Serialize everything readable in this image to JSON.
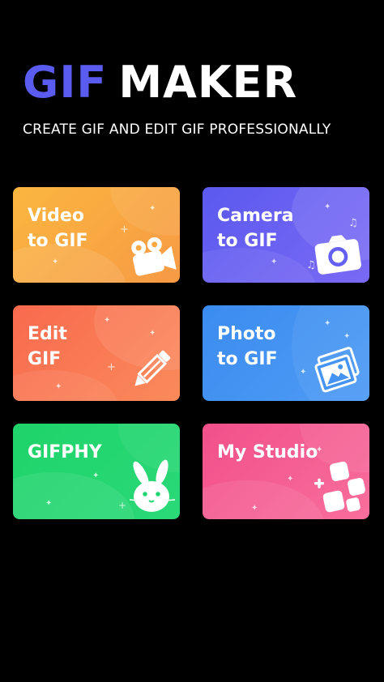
{
  "header": {
    "title_part1": "GIF",
    "title_part2": "MAKER",
    "subtitle": "CREATE GIF AND EDIT GIF PROFESSIONALLY"
  },
  "cards": {
    "video_to_gif": {
      "label": "Video\nto GIF",
      "icon": "video-camera-icon",
      "color": "#f9a842"
    },
    "camera_to_gif": {
      "label": "Camera\nto GIF",
      "icon": "photo-camera-icon",
      "color": "#6461f2"
    },
    "edit_gif": {
      "label": "Edit\nGIF",
      "icon": "pencil-icon",
      "color": "#f97752"
    },
    "photo_to_gif": {
      "label": "Photo\nto GIF",
      "icon": "photos-icon",
      "color": "#4593f2"
    },
    "giphy": {
      "label": "GIFPHY",
      "icon": "bunny-icon",
      "color": "#24d670"
    },
    "my_studio": {
      "label": "My Studio",
      "icon": "apps-grid-icon",
      "color": "#f45c92"
    }
  },
  "colors": {
    "background": "#000000",
    "title_accent": "#5a5cf0",
    "text": "#ffffff"
  }
}
